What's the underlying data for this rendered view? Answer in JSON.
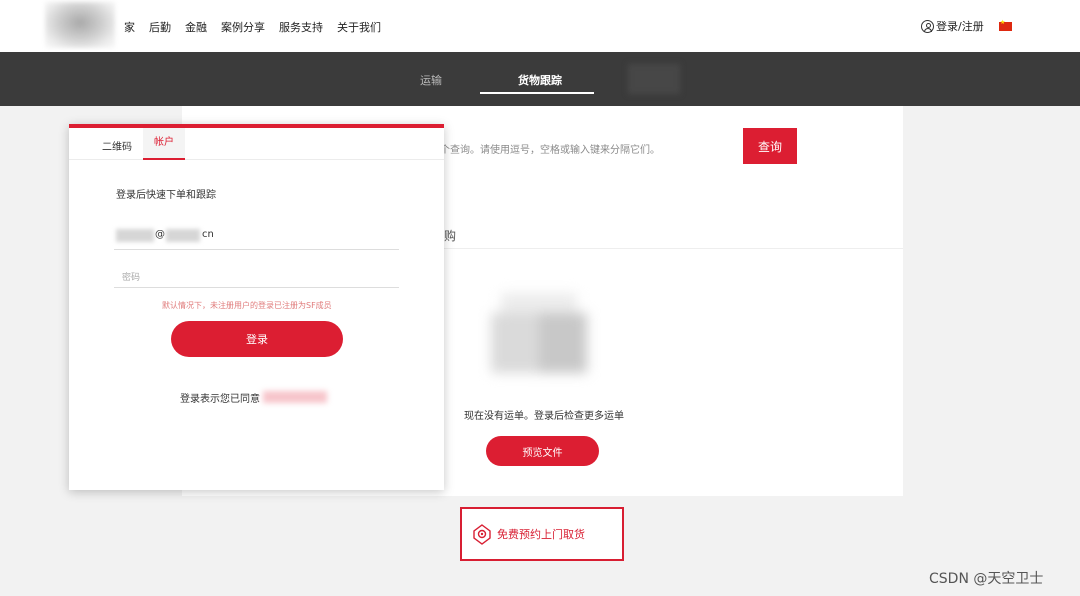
{
  "header": {
    "nav": [
      "家",
      "后勤",
      "金融",
      "案例分享",
      "服务支持",
      "关于我们"
    ],
    "login_label": "登录/注册"
  },
  "tabbar": {
    "tabs": [
      "运输",
      "货物跟踪"
    ],
    "active": "货物跟踪"
  },
  "main": {
    "search_placeholder": "个查询。请使用逗号，空格或输入键来分隔它们。",
    "search_button": "查询",
    "buy_text": "购",
    "empty_text": "现在没有运单。登录后检查更多运单",
    "preview_button": "预览文件",
    "pickup_text": "免费预约上门取货"
  },
  "login_card": {
    "tabs": [
      "二维码",
      "帐户"
    ],
    "active_tab": "帐户",
    "subtitle": "登录后快速下单和跟踪",
    "email_at": "@",
    "email_tld": "cn",
    "password_placeholder": "密码",
    "note": "默认情况下，未注册用户的登录已注册为SF成员",
    "login_button": "登录",
    "agree_text": "登录表示您已同意"
  },
  "watermark": "CSDN @天空卫士",
  "colors": {
    "accent": "#dc1e32",
    "tabbar": "#3b3b3b"
  }
}
